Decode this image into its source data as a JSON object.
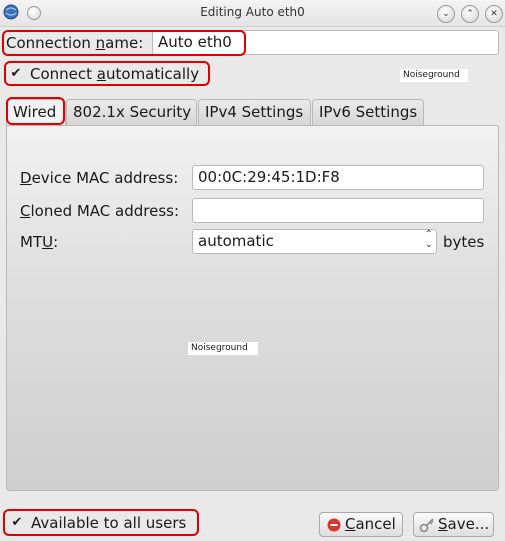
{
  "window": {
    "title": "Editing Auto eth0",
    "app_icon": "network-globe-icon",
    "buttons": [
      "minimize-icon",
      "maximize-icon",
      "close-icon"
    ]
  },
  "connection_name": {
    "label_pre": "Connection ",
    "label_accel": "n",
    "label_post": "ame:",
    "value": "Auto eth0"
  },
  "connect_automatically": {
    "checked": true,
    "label_pre": "Connect ",
    "label_accel": "a",
    "label_post": "utomatically"
  },
  "noiseground_top": "Noiseground",
  "tabs": [
    {
      "label": "Wired",
      "active": true
    },
    {
      "label": "802.1x Security",
      "active": false
    },
    {
      "label": "IPv4 Settings",
      "active": false
    },
    {
      "label": "IPv6 Settings",
      "active": false
    }
  ],
  "wired": {
    "device_mac": {
      "label_accel": "D",
      "label_rest": "evice MAC address:",
      "value": "00:0C:29:45:1D:F8"
    },
    "cloned_mac": {
      "label_accel": "C",
      "label_rest": "loned MAC address:",
      "value": ""
    },
    "mtu": {
      "label_pre": "MT",
      "label_accel": "U",
      "label_post": ":",
      "value": "automatic",
      "unit": "bytes"
    }
  },
  "noiseground_mid": "Noiseground",
  "available_to_all_users": {
    "checked": true,
    "label": "Available to all users"
  },
  "buttons": {
    "cancel": {
      "accel": "C",
      "rest": "ancel"
    },
    "save": {
      "accel": "S",
      "rest": "ave..."
    }
  },
  "colors": {
    "highlight": "#e00000",
    "cancel_icon": "#d9342b"
  }
}
